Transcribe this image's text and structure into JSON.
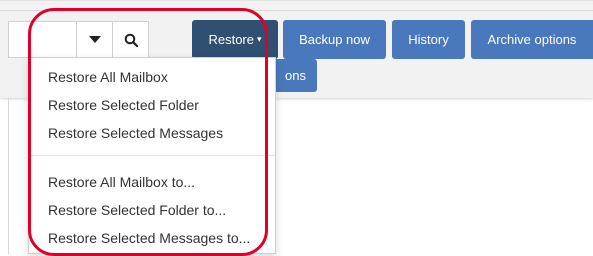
{
  "toolbar": {
    "restore_label": "Restore",
    "restore_caret": "▾",
    "backup_label": "Backup now",
    "history_label": "History",
    "archive_label": "Archive options",
    "options_partial_label": "ons"
  },
  "icons": {
    "dropdown": "chevron-down-icon",
    "search": "search-icon"
  },
  "colors": {
    "primary_button": "#4a78bd",
    "active_button": "#2f4f73",
    "highlight_ring": "#e0002a"
  },
  "restore_menu": {
    "items": [
      "Restore All Mailbox",
      "Restore Selected Folder",
      "Restore Selected Messages",
      "Restore All Mailbox to...",
      "Restore Selected Folder to...",
      "Restore Selected Messages to..."
    ]
  }
}
